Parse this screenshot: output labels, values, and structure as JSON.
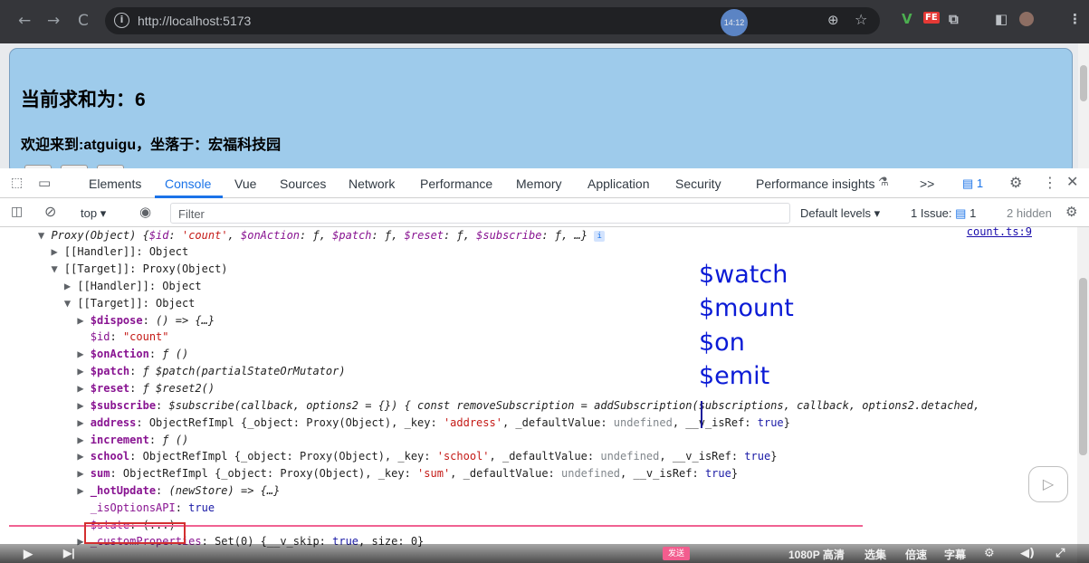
{
  "browser": {
    "url": "http://localhost:5173",
    "time_bubble": "14:12",
    "nav": {
      "back": "←",
      "forward": "→",
      "reload": "C"
    },
    "extensions": [
      "V",
      "FE"
    ]
  },
  "page": {
    "sum_text": "当前求和为：6",
    "welcome_text": "欢迎来到:atguigu，坐落于：宏福科技园"
  },
  "devtools": {
    "tabs": [
      "Elements",
      "Console",
      "Vue",
      "Sources",
      "Network",
      "Performance",
      "Memory",
      "Application",
      "Security",
      "Performance insights"
    ],
    "active_tab": "Console",
    "more_tabs": ">>",
    "issues_count": "1",
    "context": "top",
    "filter_placeholder": "Filter",
    "default_levels": "Default levels",
    "issue_label": "1 Issue:",
    "issue_count_small": "1",
    "hidden_label": "2 hidden"
  },
  "console": {
    "source_link": "count.ts:9",
    "lines": [
      {
        "t": "▼",
        "pre": "",
        "parts": [
          [
            "it",
            "Proxy(Object) {"
          ],
          [
            "it keyp",
            "$id"
          ],
          [
            "it",
            ": "
          ],
          [
            "it str",
            "'count'"
          ],
          [
            "it",
            ", "
          ],
          [
            "it keyp",
            "$onAction"
          ],
          [
            "it",
            ": "
          ],
          [
            "it",
            "ƒ"
          ],
          [
            "it",
            ", "
          ],
          [
            "it keyp",
            "$patch"
          ],
          [
            "it",
            ": "
          ],
          [
            "it",
            "ƒ"
          ],
          [
            "it",
            ", "
          ],
          [
            "it keyp",
            "$reset"
          ],
          [
            "it",
            ": "
          ],
          [
            "it",
            "ƒ"
          ],
          [
            "it",
            ", "
          ],
          [
            "it keyp",
            "$subscribe"
          ],
          [
            "it",
            ": "
          ],
          [
            "it",
            "ƒ"
          ],
          [
            "it",
            ", …}"
          ]
        ]
      },
      {
        "t": "▶",
        "pre": "  ",
        "parts": [
          [
            "",
            "[[Handler]]: Object"
          ]
        ]
      },
      {
        "t": "▼",
        "pre": "  ",
        "parts": [
          [
            "",
            "[[Target]]: Proxy(Object)"
          ]
        ]
      },
      {
        "t": "▶",
        "pre": "    ",
        "parts": [
          [
            "",
            "[[Handler]]: Object"
          ]
        ]
      },
      {
        "t": "▼",
        "pre": "    ",
        "parts": [
          [
            "",
            "[[Target]]: Object"
          ]
        ]
      },
      {
        "t": "▶",
        "pre": "      ",
        "parts": [
          [
            "key",
            "$dispose"
          ],
          [
            "",
            ": "
          ],
          [
            "it",
            "() => {…}"
          ]
        ]
      },
      {
        "t": " ",
        "pre": "      ",
        "parts": [
          [
            "keyp",
            "$id"
          ],
          [
            "",
            ": "
          ],
          [
            "str",
            "\"count\""
          ]
        ]
      },
      {
        "t": "▶",
        "pre": "      ",
        "parts": [
          [
            "key",
            "$onAction"
          ],
          [
            "",
            ": "
          ],
          [
            "it",
            "ƒ ()"
          ]
        ]
      },
      {
        "t": "▶",
        "pre": "      ",
        "parts": [
          [
            "key",
            "$patch"
          ],
          [
            "",
            ": "
          ],
          [
            "it",
            "ƒ $patch(partialStateOrMutator)"
          ]
        ]
      },
      {
        "t": "▶",
        "pre": "      ",
        "parts": [
          [
            "key",
            "$reset"
          ],
          [
            "",
            ": "
          ],
          [
            "it",
            "ƒ $reset2()"
          ]
        ]
      },
      {
        "t": "▶",
        "pre": "      ",
        "parts": [
          [
            "key",
            "$subscribe"
          ],
          [
            "",
            ": "
          ],
          [
            "it",
            "$subscribe(callback, options2 = {}) { const removeSubscription = addSubscription(subscriptions, callback, options2.detached,"
          ]
        ]
      },
      {
        "t": "▶",
        "pre": "      ",
        "parts": [
          [
            "key",
            "address"
          ],
          [
            "",
            ": ObjectRefImpl {_object: Proxy(Object), _key: "
          ],
          [
            "str",
            "'address'"
          ],
          [
            "",
            ", _defaultValue: "
          ],
          [
            "dim",
            "undefined"
          ],
          [
            "",
            ", __v_isRef: "
          ],
          [
            "kw",
            "true"
          ],
          [
            "",
            "}"
          ]
        ]
      },
      {
        "t": "▶",
        "pre": "      ",
        "parts": [
          [
            "key",
            "increment"
          ],
          [
            "",
            ": "
          ],
          [
            "it",
            "ƒ ()"
          ]
        ]
      },
      {
        "t": "▶",
        "pre": "      ",
        "parts": [
          [
            "key",
            "school"
          ],
          [
            "",
            ": ObjectRefImpl {_object: Proxy(Object), _key: "
          ],
          [
            "str",
            "'school'"
          ],
          [
            "",
            ", _defaultValue: "
          ],
          [
            "dim",
            "undefined"
          ],
          [
            "",
            ", __v_isRef: "
          ],
          [
            "kw",
            "true"
          ],
          [
            "",
            "}"
          ]
        ]
      },
      {
        "t": "▶",
        "pre": "      ",
        "parts": [
          [
            "key",
            "sum"
          ],
          [
            "",
            ": ObjectRefImpl {_object: Proxy(Object), _key: "
          ],
          [
            "str",
            "'sum'"
          ],
          [
            "",
            ", _defaultValue: "
          ],
          [
            "dim",
            "undefined"
          ],
          [
            "",
            ", __v_isRef: "
          ],
          [
            "kw",
            "true"
          ],
          [
            "",
            "}"
          ]
        ]
      },
      {
        "t": "▶",
        "pre": "      ",
        "parts": [
          [
            "key",
            "_hotUpdate"
          ],
          [
            "",
            ": "
          ],
          [
            "it",
            "(newStore) => {…}"
          ]
        ]
      },
      {
        "t": " ",
        "pre": "      ",
        "parts": [
          [
            "keyp",
            "_isOptionsAPI"
          ],
          [
            "",
            ": "
          ],
          [
            "kw",
            "true"
          ]
        ]
      },
      {
        "t": " ",
        "pre": "      ",
        "parts": [
          [
            "keyp",
            "$state"
          ],
          [
            "",
            ": (...)"
          ]
        ]
      },
      {
        "t": "▶",
        "pre": "      ",
        "parts": [
          [
            "keyp",
            "_customProperties"
          ],
          [
            "",
            ": Set(0) {__v_skip: "
          ],
          [
            "kw",
            "true"
          ],
          [
            "",
            ", size: 0}"
          ]
        ]
      }
    ]
  },
  "annotations": [
    "$watch",
    "$mount",
    "$on",
    "$emit"
  ],
  "video_controls": {
    "danmaku": "发送",
    "quality": "1080P 高清",
    "episodes": "选集",
    "speed": "倍速",
    "subtitle": "字幕"
  }
}
